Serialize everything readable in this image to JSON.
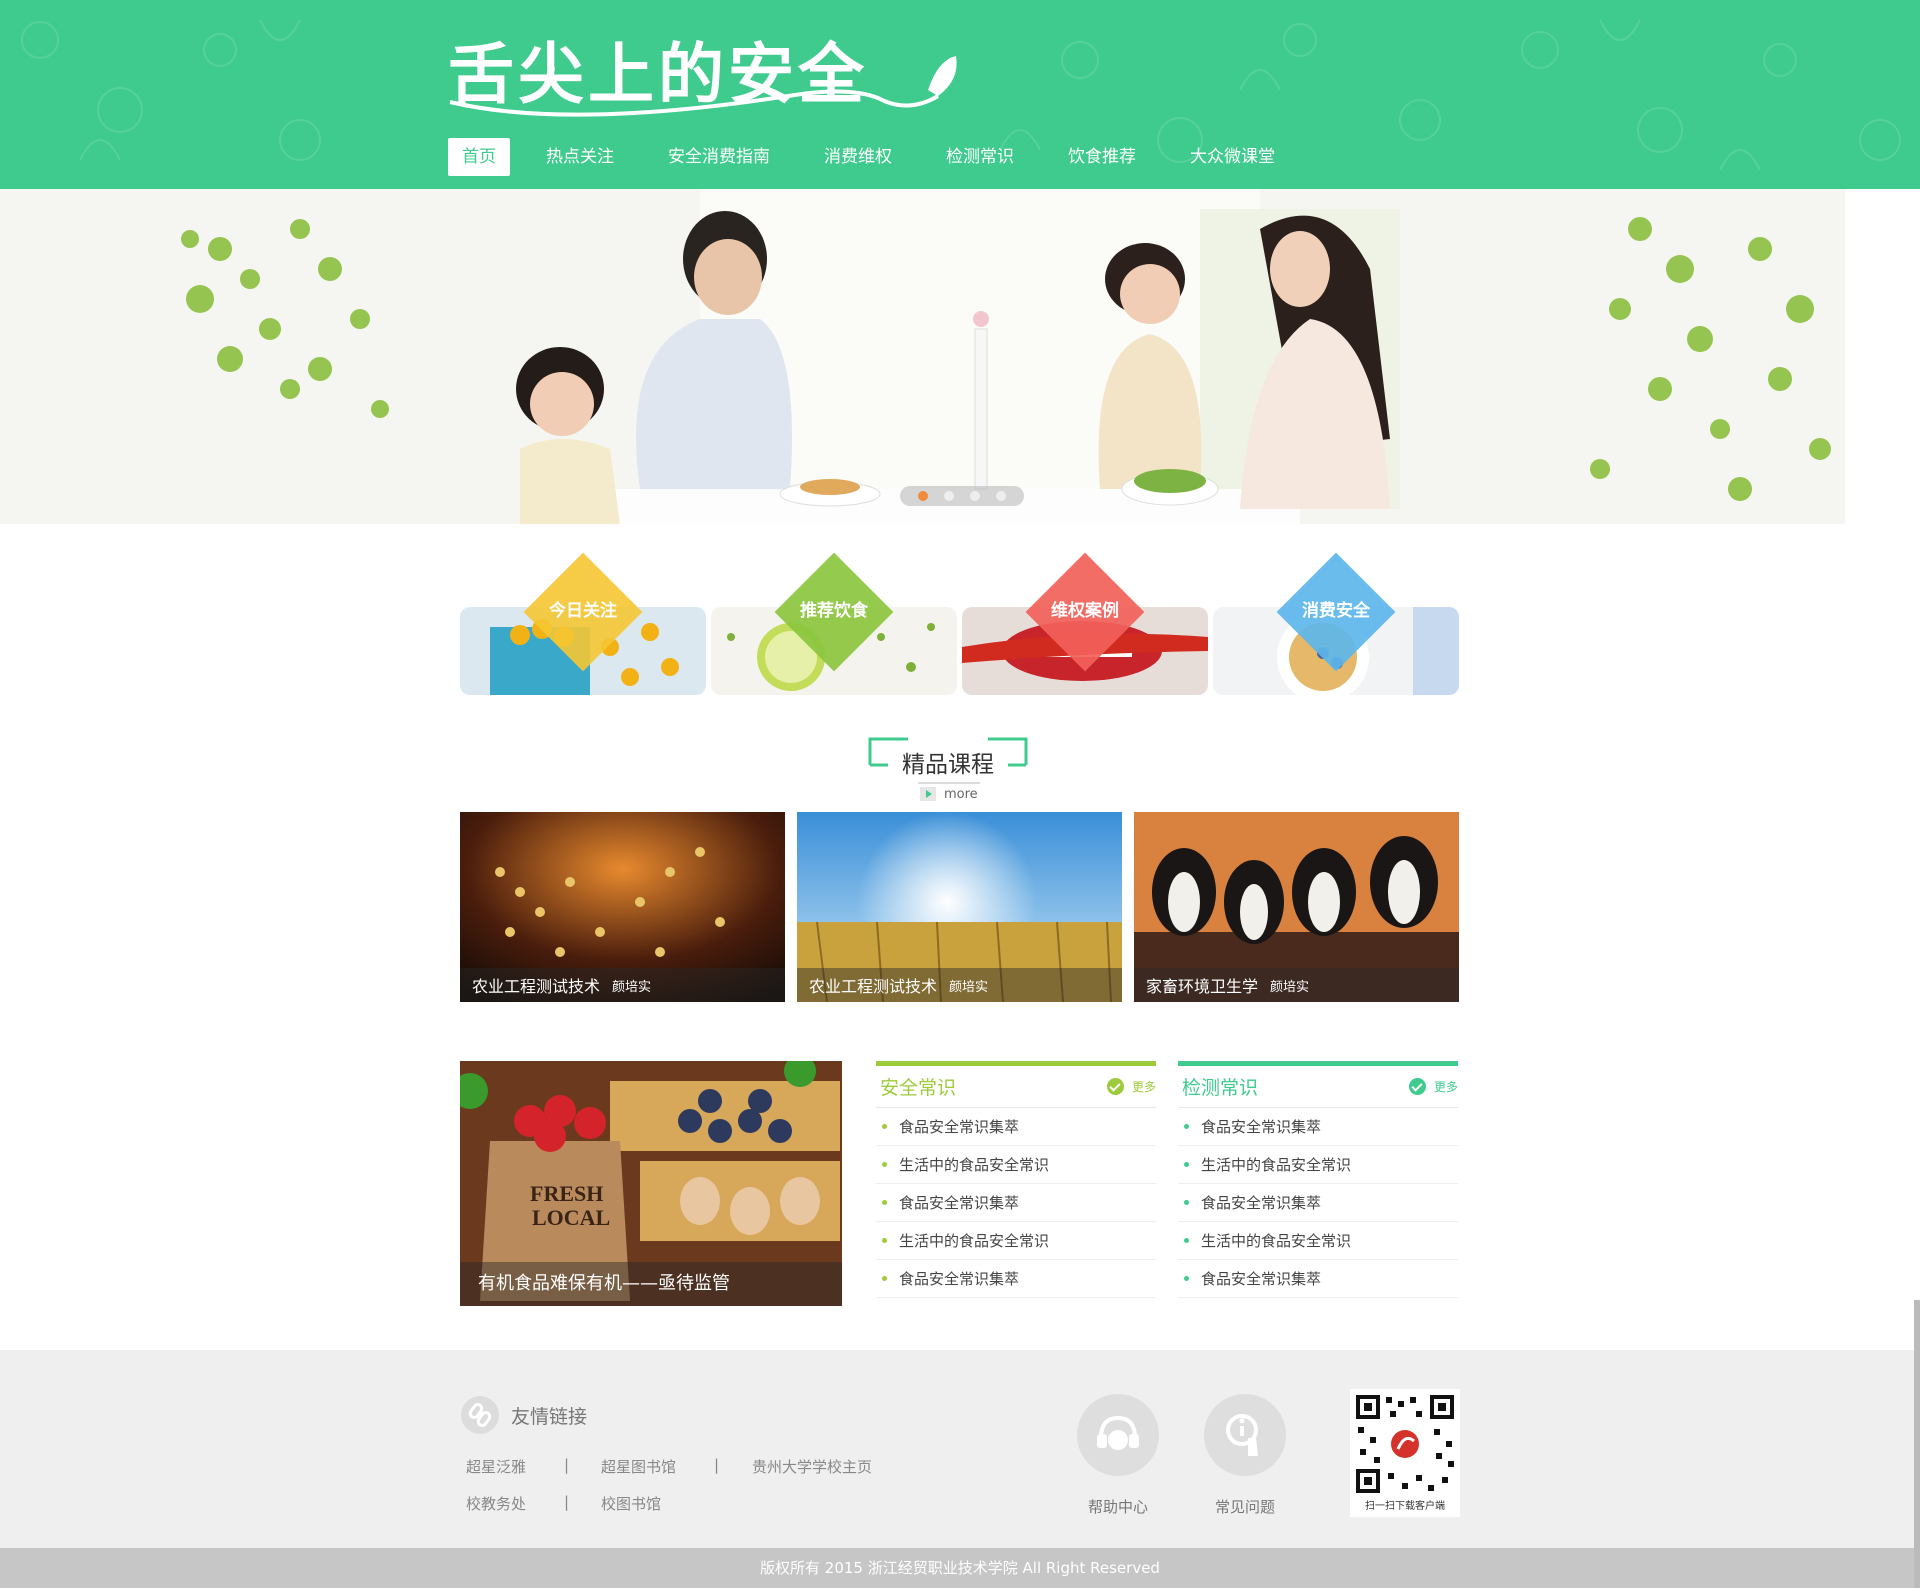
{
  "header": {
    "logo_text": "舌尖上的安全",
    "nav": [
      {
        "label": "首页",
        "active": true
      },
      {
        "label": "热点关注"
      },
      {
        "label": "安全消费指南"
      },
      {
        "label": "消费维权"
      },
      {
        "label": "检测常识"
      },
      {
        "label": "饮食推荐"
      },
      {
        "label": "大众微课堂"
      }
    ]
  },
  "banner": {
    "slides": 4,
    "active_slide": 1
  },
  "categories": [
    {
      "label": "今日关注",
      "color": "#f5c633"
    },
    {
      "label": "推荐饮食",
      "color": "#8bc63e"
    },
    {
      "label": "维权案例",
      "color": "#f2615a"
    },
    {
      "label": "消费安全",
      "color": "#5cb6ea"
    }
  ],
  "courses_section": {
    "title": "精品课程",
    "more": "more",
    "items": [
      {
        "name": "农业工程测试技术",
        "teacher": "颜培实"
      },
      {
        "name": "农业工程测试技术",
        "teacher": "颜培实"
      },
      {
        "name": "家畜环境卫生学",
        "teacher": "颜培实"
      }
    ]
  },
  "feature": {
    "caption": "有机食品难保有机——亟待监管"
  },
  "info_columns": [
    {
      "title": "安全常识",
      "more": "更多",
      "color": "#9ccb3b",
      "items": [
        "食品安全常识集萃",
        "生活中的食品安全常识",
        "食品安全常识集萃",
        "生活中的食品安全常识",
        "食品安全常识集萃"
      ]
    },
    {
      "title": "检测常识",
      "more": "更多",
      "color": "#3fcb8e",
      "items": [
        "食品安全常识集萃",
        "生活中的食品安全常识",
        "食品安全常识集萃",
        "生活中的食品安全常识",
        "食品安全常识集萃"
      ]
    }
  ],
  "footer": {
    "links_title": "友情链接",
    "links_row1": [
      "超星泛雅",
      "超星图书馆",
      "贵州大学学校主页"
    ],
    "links_row2": [
      "校教务处",
      "校图书馆"
    ],
    "separator": "|",
    "help_center": "帮助中心",
    "faq": "常见问题",
    "qr_caption": "扫一扫下载客户端",
    "copyright": "版权所有 2015 浙江经贸职业技术学院 All Right Reserved"
  },
  "colors": {
    "brand_green": "#3fcb8e",
    "lime": "#9ccb3b"
  }
}
